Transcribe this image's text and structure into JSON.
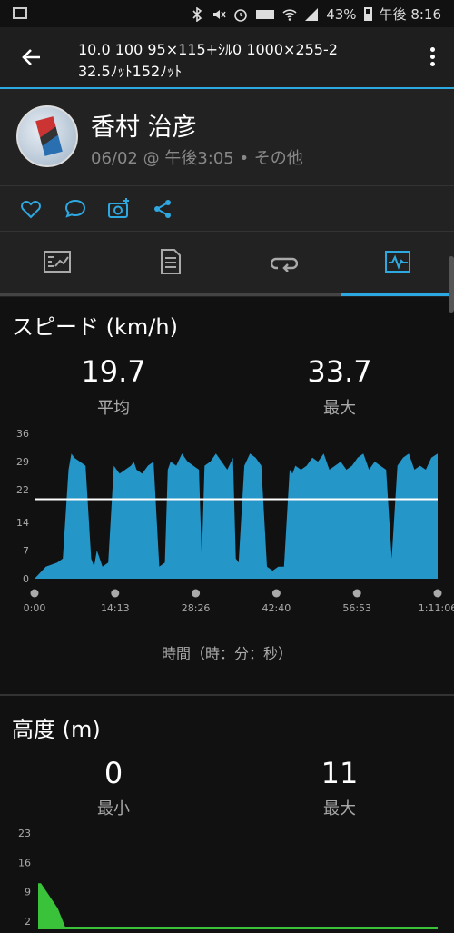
{
  "status_bar": {
    "battery": "43%",
    "time": "午後 8:16",
    "icons": [
      "image-icon",
      "bluetooth-icon",
      "mute-icon",
      "alarm-icon",
      "volte-icon",
      "wifi-icon",
      "signal-icon",
      "battery-icon"
    ]
  },
  "app_bar": {
    "title_line1": "10.0 100 95×115+ｼﾙ0 1000×255-2",
    "title_line2": "32.5ﾉｯﾄ152ﾉｯﾄ"
  },
  "profile": {
    "name": "香村 治彦",
    "meta": "06/02 @ 午後3:05 • その他"
  },
  "actions": [
    "like-icon",
    "comment-icon",
    "add-photo-icon",
    "share-icon"
  ],
  "tabs": [
    "summary-tab",
    "details-tab",
    "laps-tab",
    "charts-tab"
  ],
  "speed": {
    "title": "スピード (km/h)",
    "avg_value": "19.7",
    "avg_label": "平均",
    "max_value": "33.7",
    "max_label": "最大",
    "x_axis_name": "時間（時：分：秒）"
  },
  "altitude": {
    "title": "高度 (m)",
    "min_value": "0",
    "min_label": "最小",
    "max_value": "11",
    "max_label": "最大"
  },
  "colors": {
    "accent": "#2ea8e0",
    "speed_fill": "#2596c8",
    "altitude_fill": "#3bc23b",
    "background": "#111111"
  },
  "chart_data": [
    {
      "type": "area",
      "ylabel": "スピード (km/h)",
      "xlabel": "時間（時：分：秒）",
      "y_ticks": [
        "0",
        "7",
        "14",
        "22",
        "29",
        "36"
      ],
      "x_ticks": [
        "0:00",
        "14:13",
        "28:26",
        "42:40",
        "56:53",
        "1:11:06"
      ],
      "ylim": [
        0,
        36
      ],
      "average_line": 19.7,
      "x": [
        0,
        2,
        4,
        5,
        6,
        6.5,
        7,
        8,
        9,
        10,
        10.5,
        11,
        11.5,
        12,
        13,
        14,
        14.5,
        15,
        16,
        17,
        17.5,
        18,
        19,
        20,
        21,
        22,
        23,
        23.5,
        24,
        25,
        26,
        27,
        28,
        29,
        29.5,
        30,
        31,
        32,
        33,
        34,
        35,
        35.5,
        36,
        37,
        38,
        39,
        40,
        41,
        42,
        43,
        44,
        45,
        45.5,
        46,
        47,
        48,
        49,
        50,
        51,
        52,
        53,
        54,
        55,
        56,
        57,
        58,
        59,
        60,
        61,
        62,
        63,
        64,
        65,
        66,
        67,
        68,
        69,
        70,
        71.1
      ],
      "y": [
        0,
        3,
        4,
        5,
        27,
        31,
        30,
        29,
        28,
        5,
        3,
        7,
        5,
        3,
        4,
        28,
        27,
        26,
        27,
        28,
        29,
        27,
        26,
        28,
        29,
        3,
        4,
        27,
        29,
        28,
        31,
        29,
        28,
        27,
        5,
        28,
        29,
        31,
        29,
        27,
        30,
        5,
        4,
        28,
        31,
        30,
        28,
        3,
        2,
        3,
        3,
        27,
        26,
        28,
        27,
        28,
        30,
        29,
        31,
        27,
        28,
        29,
        27,
        28,
        30,
        31,
        27,
        29,
        28,
        27,
        5,
        28,
        30,
        31,
        27,
        28,
        27,
        30,
        31
      ]
    },
    {
      "type": "area",
      "ylabel": "高度 (m)",
      "y_ticks": [
        "2",
        "9",
        "16",
        "23"
      ],
      "ylim": [
        0,
        23
      ],
      "x": [
        0,
        0.5,
        1.5,
        2.5,
        3.5,
        5,
        71.1
      ],
      "y": [
        11,
        11,
        9,
        7,
        5,
        0,
        0
      ]
    }
  ]
}
